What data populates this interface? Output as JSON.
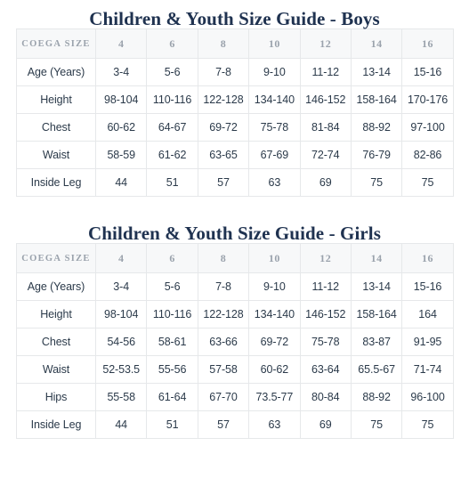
{
  "tables": [
    {
      "title": "Children & Youth Size Guide - Boys",
      "label_header": "COEGA SIZE",
      "size_headers": [
        "4",
        "6",
        "8",
        "10",
        "12",
        "14",
        "16"
      ],
      "rows": [
        {
          "label": "Age (Years)",
          "values": [
            "3-4",
            "5-6",
            "7-8",
            "9-10",
            "11-12",
            "13-14",
            "15-16"
          ]
        },
        {
          "label": "Height",
          "values": [
            "98-104",
            "110-116",
            "122-128",
            "134-140",
            "146-152",
            "158-164",
            "170-176"
          ]
        },
        {
          "label": "Chest",
          "values": [
            "60-62",
            "64-67",
            "69-72",
            "75-78",
            "81-84",
            "88-92",
            "97-100"
          ]
        },
        {
          "label": "Waist",
          "values": [
            "58-59",
            "61-62",
            "63-65",
            "67-69",
            "72-74",
            "76-79",
            "82-86"
          ]
        },
        {
          "label": "Inside Leg",
          "values": [
            "44",
            "51",
            "57",
            "63",
            "69",
            "75",
            "75"
          ]
        }
      ]
    },
    {
      "title": "Children & Youth Size Guide - Girls",
      "label_header": "COEGA SIZE",
      "size_headers": [
        "4",
        "6",
        "8",
        "10",
        "12",
        "14",
        "16"
      ],
      "rows": [
        {
          "label": "Age (Years)",
          "values": [
            "3-4",
            "5-6",
            "7-8",
            "9-10",
            "11-12",
            "13-14",
            "15-16"
          ]
        },
        {
          "label": "Height",
          "values": [
            "98-104",
            "110-116",
            "122-128",
            "134-140",
            "146-152",
            "158-164",
            "164"
          ]
        },
        {
          "label": "Chest",
          "values": [
            "54-56",
            "58-61",
            "63-66",
            "69-72",
            "75-78",
            "83-87",
            "91-95"
          ]
        },
        {
          "label": "Waist",
          "values": [
            "52-53.5",
            "55-56",
            "57-58",
            "60-62",
            "63-64",
            "65.5-67",
            "71-74"
          ]
        },
        {
          "label": "Hips",
          "values": [
            "55-58",
            "61-64",
            "67-70",
            "73.5-77",
            "80-84",
            "88-92",
            "96-100"
          ]
        },
        {
          "label": "Inside Leg",
          "values": [
            "44",
            "51",
            "57",
            "63",
            "69",
            "75",
            "75"
          ]
        }
      ]
    }
  ],
  "colors": {
    "title": "#1f3250",
    "header_bg": "#f7f8f9",
    "header_text": "#9aa2ac",
    "cell_text": "#2b3a4a",
    "border": "#e6e8ea"
  }
}
